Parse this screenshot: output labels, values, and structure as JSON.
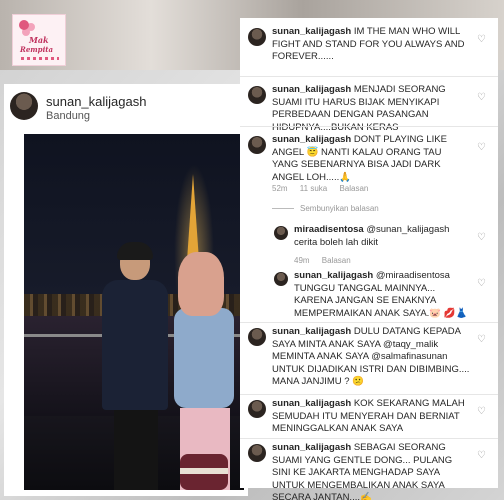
{
  "logo": {
    "line1": "Mak",
    "line2": "Rempita"
  },
  "post": {
    "username": "sunan_kalijagash",
    "location": "Bandung"
  },
  "comments": [
    {
      "user": "sunan_kalijagash",
      "text": "IM THE MAN WHO WILL FIGHT AND STAND FOR YOU ALWAYS AND FOREVER......"
    },
    {
      "user": "sunan_kalijagash",
      "text": "MENJADI SEORANG SUAMI ITU HARUS BIJAK MENYIKAPI PERBEDAAN DENGAN PASANGAN HIDUPNYA....BUKAN KERAS"
    },
    {
      "user": "sunan_kalijagash",
      "text": "DONT PLAYING LIKE ANGEL 😇 NANTI KALAU ORANG TAU YANG SEBENARNYA BISA JADI DARK ANGEL LOH.....🙏",
      "time": "52m",
      "likes": "11 suka",
      "reply": "Balasan"
    },
    {
      "hide_replies": "Sembunyikan balasan"
    },
    {
      "user": "miraadisentosa",
      "text": "@sunan_kalijagash cerita boleh lah dikit",
      "time": "49m",
      "reply": "Balasan"
    },
    {
      "user": "sunan_kalijagash",
      "text": "@miraadisentosa TUNGGU TANGGAL MAINNYA... KARENA JANGAN SE ENAKNYA MEMPERMAIKAN ANAK SAYA.🐷 💋👗"
    },
    {
      "user": "sunan_kalijagash",
      "text": "DULU DATANG KEPADA SAYA MINTA ANAK SAYA @taqy_malik MEMINTA ANAK SAYA @salmafinasunan UNTUK DIJADIKAN ISTRI DAN DIBIMBING.... MANA JANJIMU ? 😕"
    },
    {
      "user": "sunan_kalijagash",
      "text": "KOK SEKARANG MALAH SEMUDAH ITU MENYERAH DAN BERNIAT MENINGGALKAN ANAK SAYA"
    },
    {
      "user": "sunan_kalijagash",
      "text": "SEBAGAI SEORANG SUAMI YANG GENTLE DONG... PULANG SINI KE JAKARTA MENGHADAP SAYA UNTUK MENGEMBALIKAN ANAK SAYA SECARA JANTAN....✍"
    }
  ]
}
